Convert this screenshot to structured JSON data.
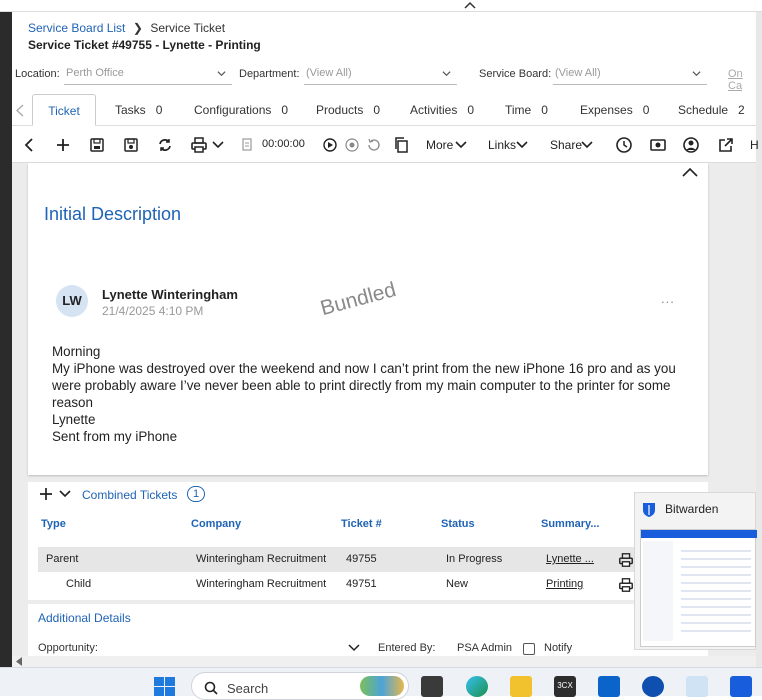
{
  "breadcrumb": {
    "link": "Service Board List",
    "current": "Service Ticket"
  },
  "ticket_title": "Service Ticket #49755 - Lynette - Printing",
  "filters": {
    "location_label": "Location:",
    "location_value": "Perth Office",
    "department_label": "Department:",
    "department_value": "(View All)",
    "board_label": "Service Board:",
    "board_value": "(View All)",
    "oncall": "On Ca"
  },
  "tabs": [
    {
      "label": "Ticket",
      "count": ""
    },
    {
      "label": "Tasks",
      "count": "0"
    },
    {
      "label": "Configurations",
      "count": "0"
    },
    {
      "label": "Products",
      "count": "0"
    },
    {
      "label": "Activities",
      "count": "0"
    },
    {
      "label": "Time",
      "count": "0"
    },
    {
      "label": "Expenses",
      "count": "0"
    },
    {
      "label": "Schedule",
      "count": "2"
    }
  ],
  "toolbar": {
    "timer": "00:00:00",
    "more": "More",
    "links": "Links",
    "share": "Share",
    "cut_label": "H"
  },
  "description": {
    "heading": "Initial Description",
    "author_initials": "LW",
    "author_name": "Lynette Winteringham",
    "timestamp": "21/4/2025 4:10 PM",
    "watermark": "Bundled",
    "menu": "...",
    "body": [
      "Morning",
      "My iPhone was destroyed over the weekend and now I can’t print from the new iPhone 16 pro and as you were probably aware I’ve never been able to print directly from my main computer to the printer for some reason",
      "Lynette",
      "Sent from my iPhone"
    ]
  },
  "combined": {
    "title": "Combined Tickets",
    "count": "1",
    "columns": [
      "Type",
      "Company",
      "Ticket #",
      "Status",
      "Summary..."
    ],
    "rows": [
      {
        "type": "Parent",
        "company": "Winteringham Recruitment",
        "ticket": "49755",
        "status": "In Progress",
        "summary": "Lynette ..."
      },
      {
        "type": "Child",
        "company": "Winteringham Recruitment",
        "ticket": "49751",
        "status": "New",
        "summary": "Printing"
      }
    ]
  },
  "details": {
    "title": "Additional Details",
    "opportunity_label": "Opportunity:",
    "entered_by_label": "Entered By:",
    "entered_by_value": "PSA Admin",
    "notify_label": "Notify"
  },
  "bitwarden": {
    "title": "Bitwarden"
  },
  "taskbar": {
    "search_placeholder": "Search",
    "app_3cx": "3CX"
  },
  "colors": {
    "accent": "#1f63b5",
    "row_parent_bg": "#e6e6e6"
  }
}
